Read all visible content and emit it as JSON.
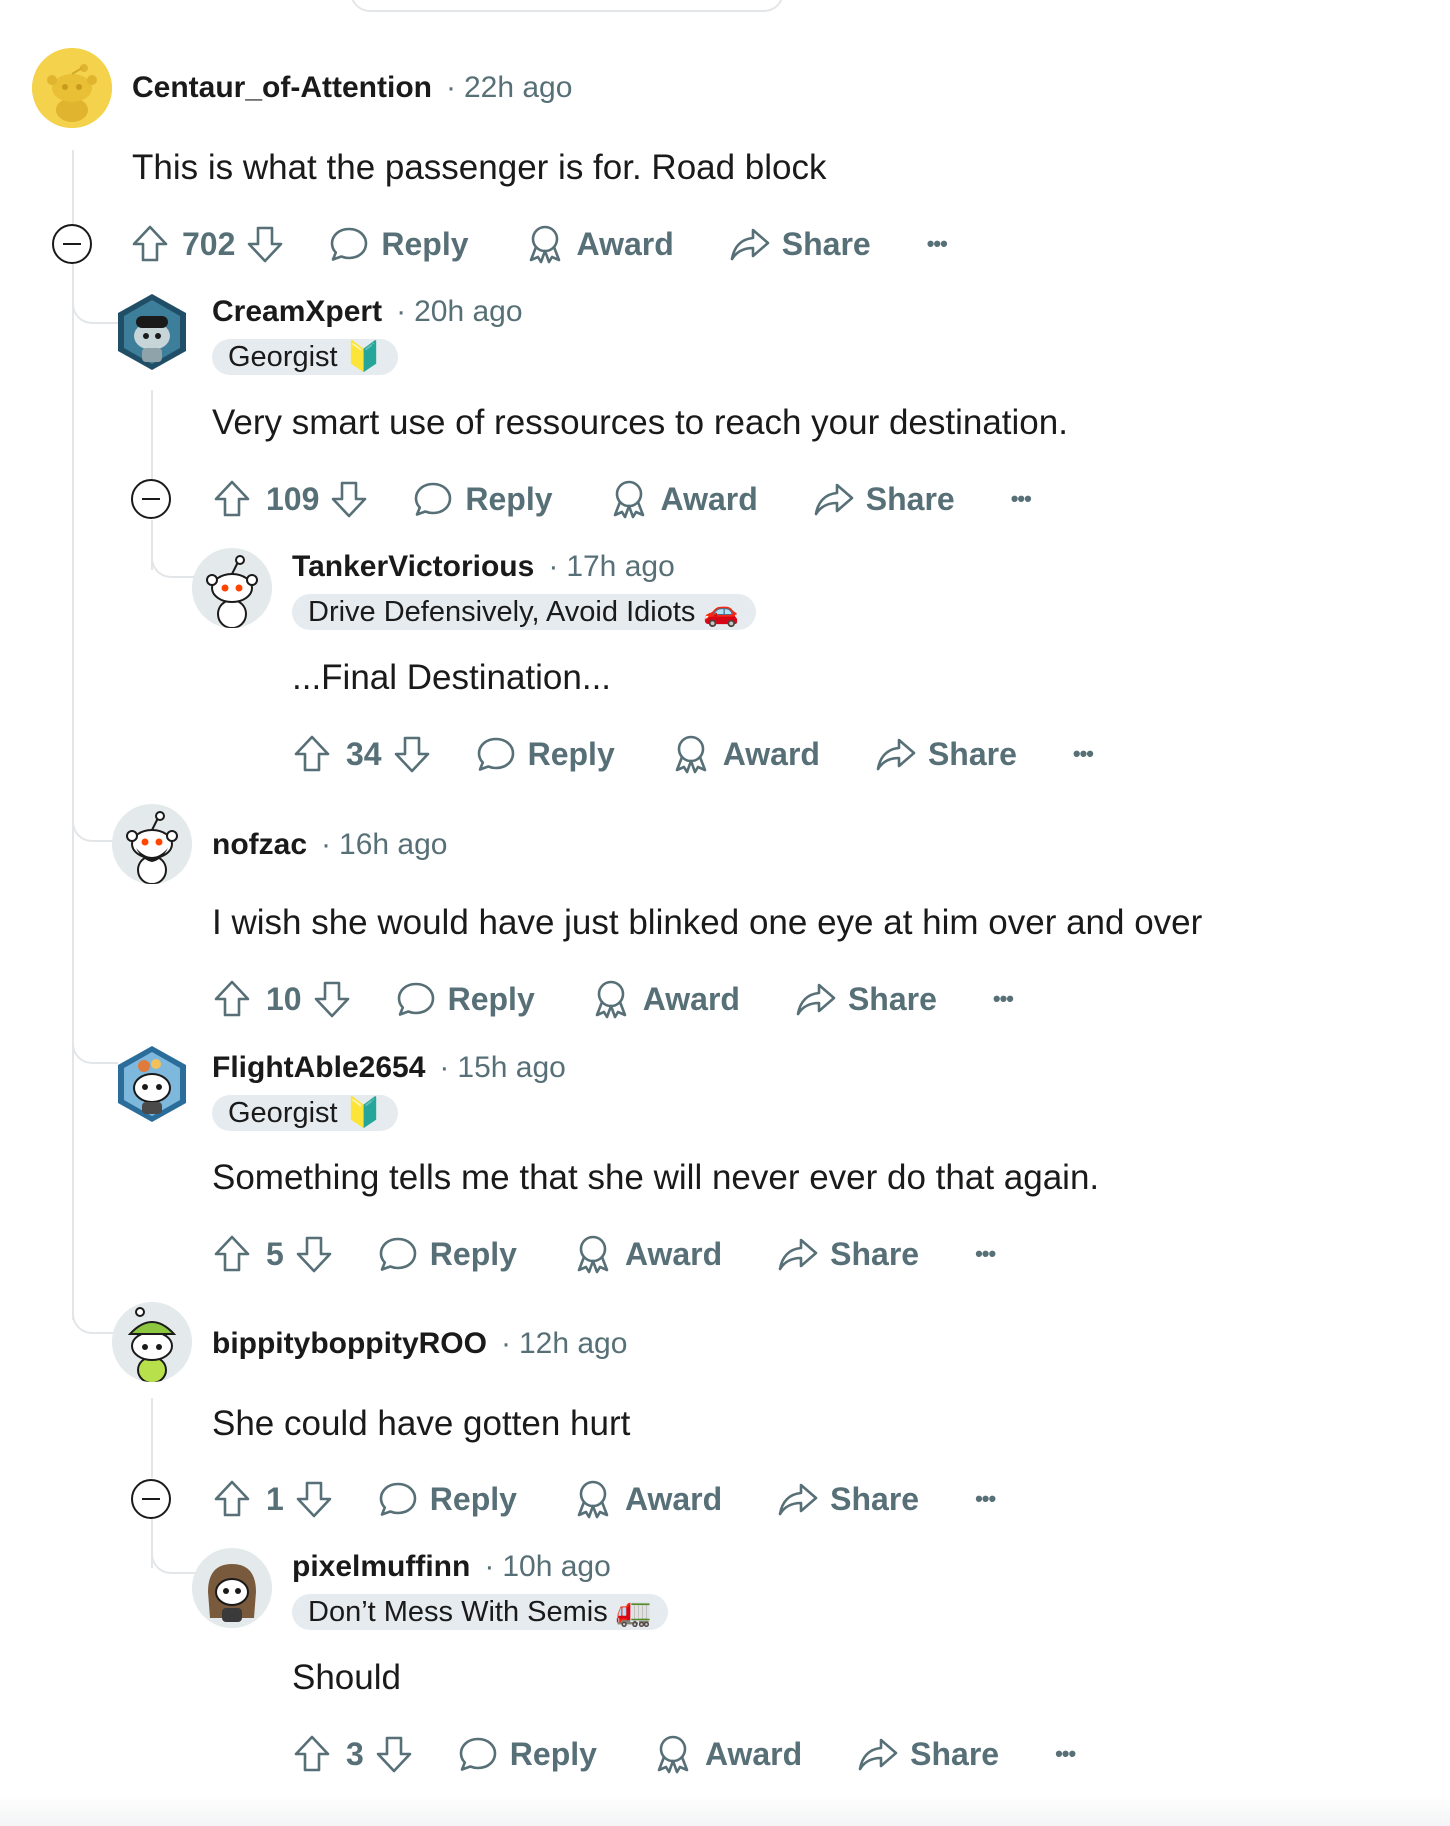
{
  "actions": {
    "reply_label": "Reply",
    "award_label": "Award",
    "share_label": "Share",
    "more_label": "•••"
  },
  "comments": [
    {
      "username": "Centaur_of-Attention",
      "time": "22h ago",
      "flair": null,
      "body": "This is what the passenger is for. Road block",
      "votes": "702",
      "avatar_icon": "snoo-avatar-yellow",
      "accent_color": "#f5d24b"
    },
    {
      "username": "CreamXpert",
      "time": "20h ago",
      "flair": "Georgist 🔰",
      "body": "Very smart use of ressources to reach your destination.",
      "votes": "109",
      "avatar_icon": "snoo-avatar-hexagon-teal"
    },
    {
      "username": "TankerVictorious",
      "time": "17h ago",
      "flair": "Drive Defensively, Avoid Idiots 🚗",
      "body": "...Final Destination...",
      "votes": "34",
      "avatar_icon": "snoo-avatar-default"
    },
    {
      "username": "nofzac",
      "time": "16h ago",
      "flair": null,
      "body": "I wish she would have just blinked one eye at him over and over",
      "votes": "10",
      "avatar_icon": "snoo-avatar-bearded"
    },
    {
      "username": "FlightAble2654",
      "time": "15h ago",
      "flair": "Georgist 🔰",
      "body": "Something tells me that she will never ever do that again.",
      "votes": "5",
      "avatar_icon": "snoo-avatar-hexagon-blue"
    },
    {
      "username": "bippityboppityROO",
      "time": "12h ago",
      "flair": null,
      "body": "She could have gotten hurt",
      "votes": "1",
      "avatar_icon": "snoo-avatar-green-hat"
    },
    {
      "username": "pixelmuffinn",
      "time": "10h ago",
      "flair": "Don’t Mess With Semis 🚛",
      "body": "Should",
      "votes": "3",
      "avatar_icon": "snoo-avatar-brown-hair"
    }
  ],
  "colors": {
    "text_primary": "#1a1a1b",
    "text_secondary": "#576f76",
    "flair_bg": "#e5ebee",
    "thread_line": "#e3e6e8"
  }
}
